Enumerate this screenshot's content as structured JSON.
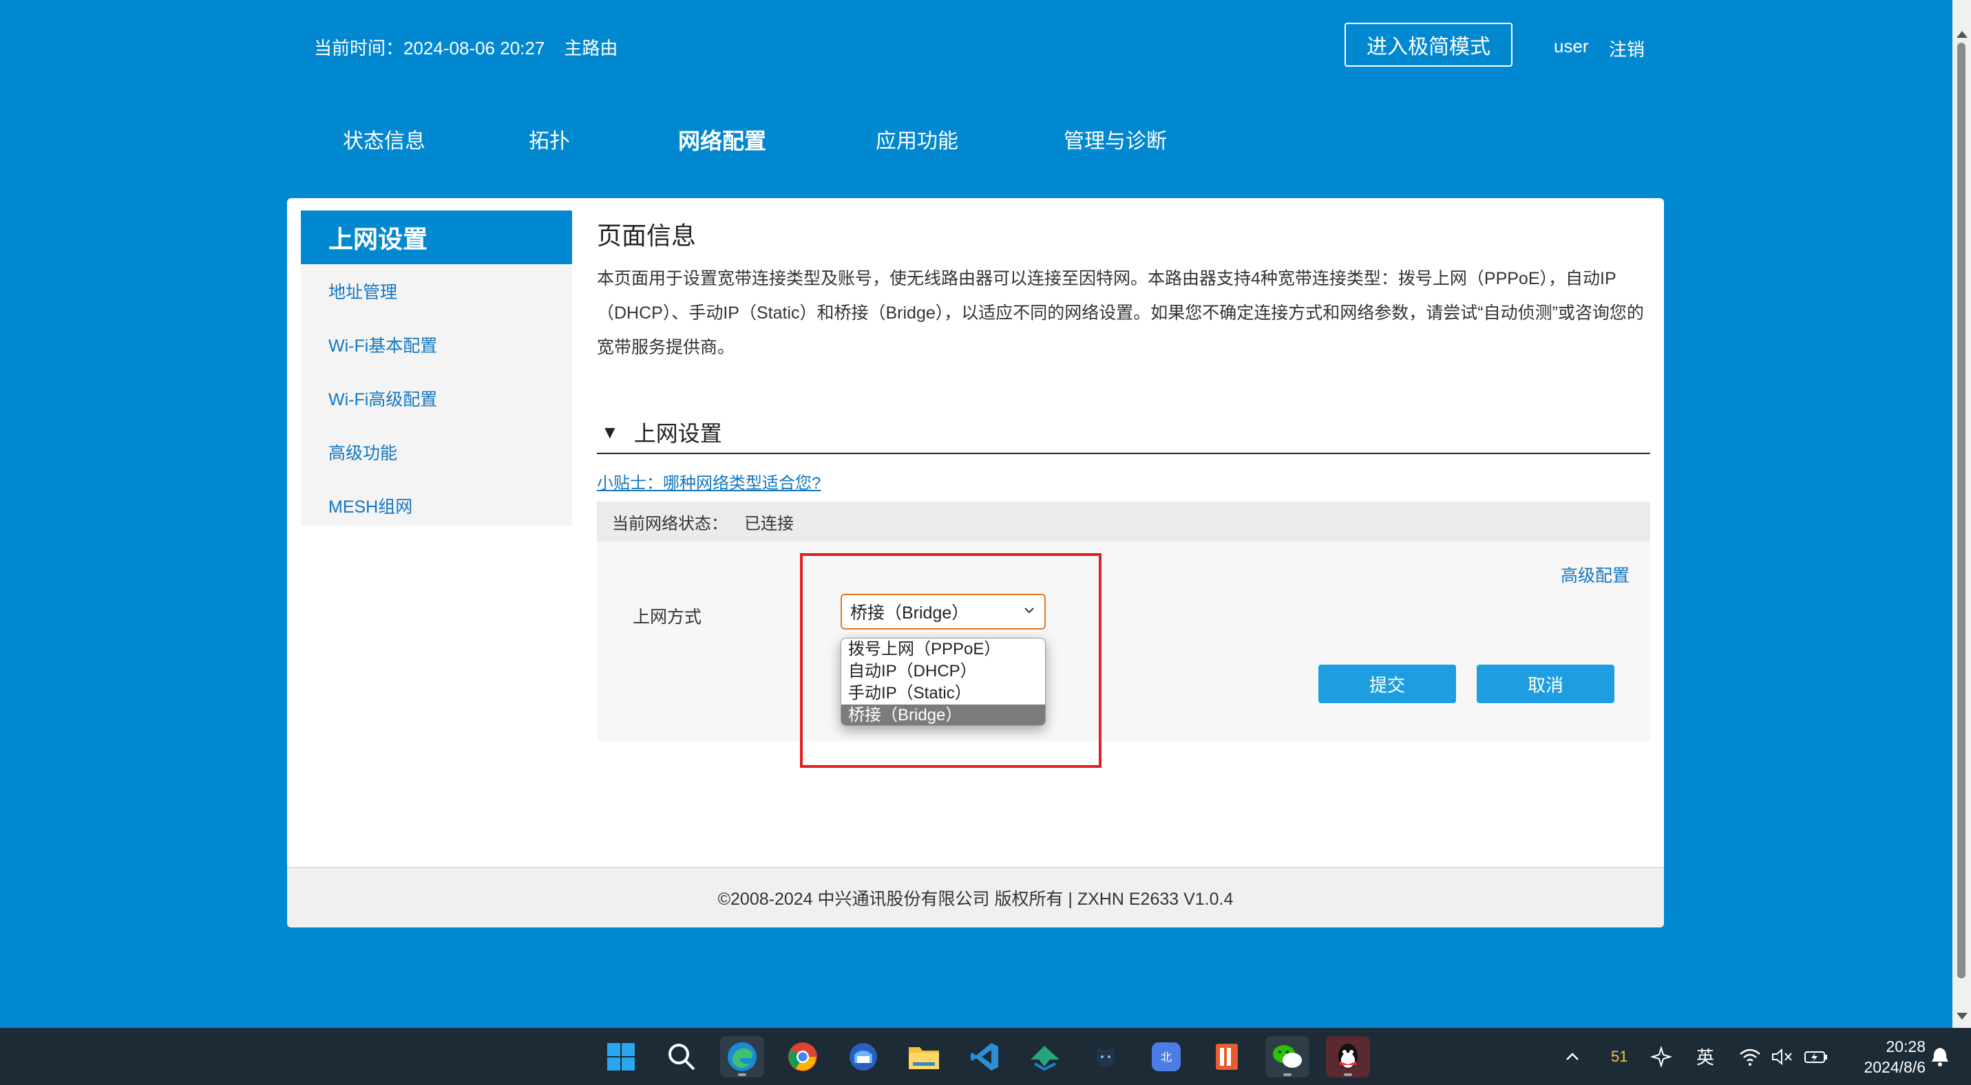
{
  "header": {
    "time_label": "当前时间：",
    "time_value": "2024-08-06 20:27",
    "mode": "主路由",
    "simple_mode_btn": "进入极简模式",
    "user": "user",
    "logout": "注销"
  },
  "nav": {
    "items": [
      {
        "label": "状态信息"
      },
      {
        "label": "拓扑"
      },
      {
        "label": "网络配置",
        "active": true
      },
      {
        "label": "应用功能"
      },
      {
        "label": "管理与诊断"
      }
    ]
  },
  "sidebar": {
    "title": "上网设置",
    "items": [
      {
        "label": "地址管理"
      },
      {
        "label": "Wi-Fi基本配置"
      },
      {
        "label": "Wi-Fi高级配置"
      },
      {
        "label": "高级功能"
      },
      {
        "label": "MESH组网"
      }
    ]
  },
  "content": {
    "page_info_title": "页面信息",
    "page_info_desc": "本页面用于设置宽带连接类型及账号，使无线路由器可以连接至因特网。本路由器支持4种宽带连接类型：拨号上网（PPPoE），自动IP（DHCP）、手动IP（Static）和桥接（Bridge），以适应不同的网络设置。如果您不确定连接方式和网络参数，请尝试“自动侦测”或咨询您的宽带服务提供商。",
    "section_title": "上网设置",
    "tip_link": "小贴士：哪种网络类型适合您?",
    "status_label": "当前网络状态：",
    "status_value": "已连接",
    "advanced_link": "高级配置",
    "wan_mode_label": "上网方式",
    "wan_mode_selected": "桥接（Bridge）",
    "wan_mode_options": [
      "拨号上网（PPPoE）",
      "自动IP（DHCP）",
      "手动IP（Static）",
      "桥接（Bridge）"
    ],
    "submit_btn": "提交",
    "cancel_btn": "取消"
  },
  "footer": {
    "copyright": "©2008-2024 中兴通讯股份有限公司 版权所有  |   ZXHN E2633 V1.0.4"
  },
  "taskbar": {
    "apps": [
      {
        "icon": "windows-start-icon"
      },
      {
        "icon": "search-icon"
      },
      {
        "icon": "edge-browser-icon",
        "active": true
      },
      {
        "icon": "chrome-icon"
      },
      {
        "icon": "thunderbird-icon"
      },
      {
        "icon": "file-explorer-icon"
      },
      {
        "icon": "vscode-icon"
      },
      {
        "icon": "app-icon"
      },
      {
        "icon": "cat-app-icon"
      },
      {
        "icon": "app-badge-icon"
      },
      {
        "icon": "notes-app-icon"
      },
      {
        "icon": "wechat-icon",
        "active": true
      },
      {
        "icon": "qq-icon",
        "active": true
      }
    ],
    "tray": {
      "temp": "51",
      "ime": "英",
      "time": "20:28",
      "date": "2024/8/6"
    }
  },
  "colors": {
    "background": "#0288d1",
    "accent": "#1e9ee0",
    "link": "#1277c1",
    "highlight": "#e02020",
    "select_border": "#e8741e"
  }
}
